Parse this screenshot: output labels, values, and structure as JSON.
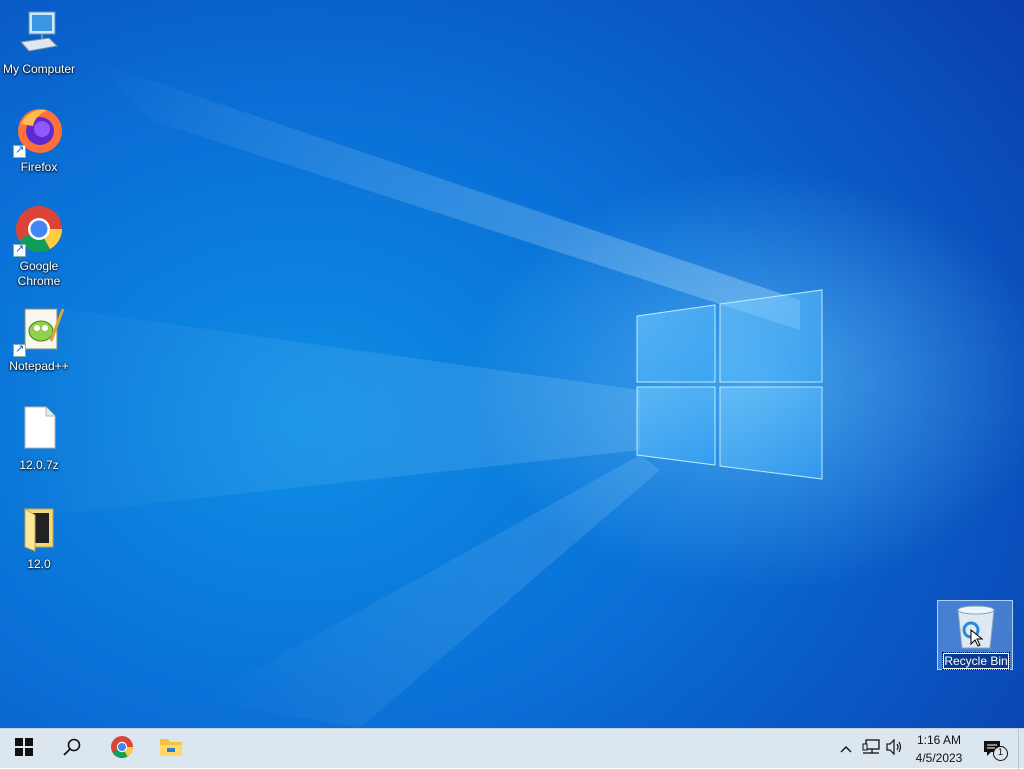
{
  "desktop": {
    "icons": [
      {
        "label": "My Computer"
      },
      {
        "label": "Firefox"
      },
      {
        "label": "Google Chrome"
      },
      {
        "label": "Notepad++"
      },
      {
        "label": "12.0.7z"
      },
      {
        "label": "12.0"
      }
    ],
    "recycle_bin": {
      "label": "Recycle Bin"
    }
  },
  "taskbar": {
    "clock_time": "1:16 AM",
    "clock_date": "4/5/2023",
    "notification_count": "1"
  },
  "colors": {
    "desktop_blue": "#0a6fd6",
    "taskbar_bg": "#dce6ef",
    "accent": "#0078d7"
  }
}
